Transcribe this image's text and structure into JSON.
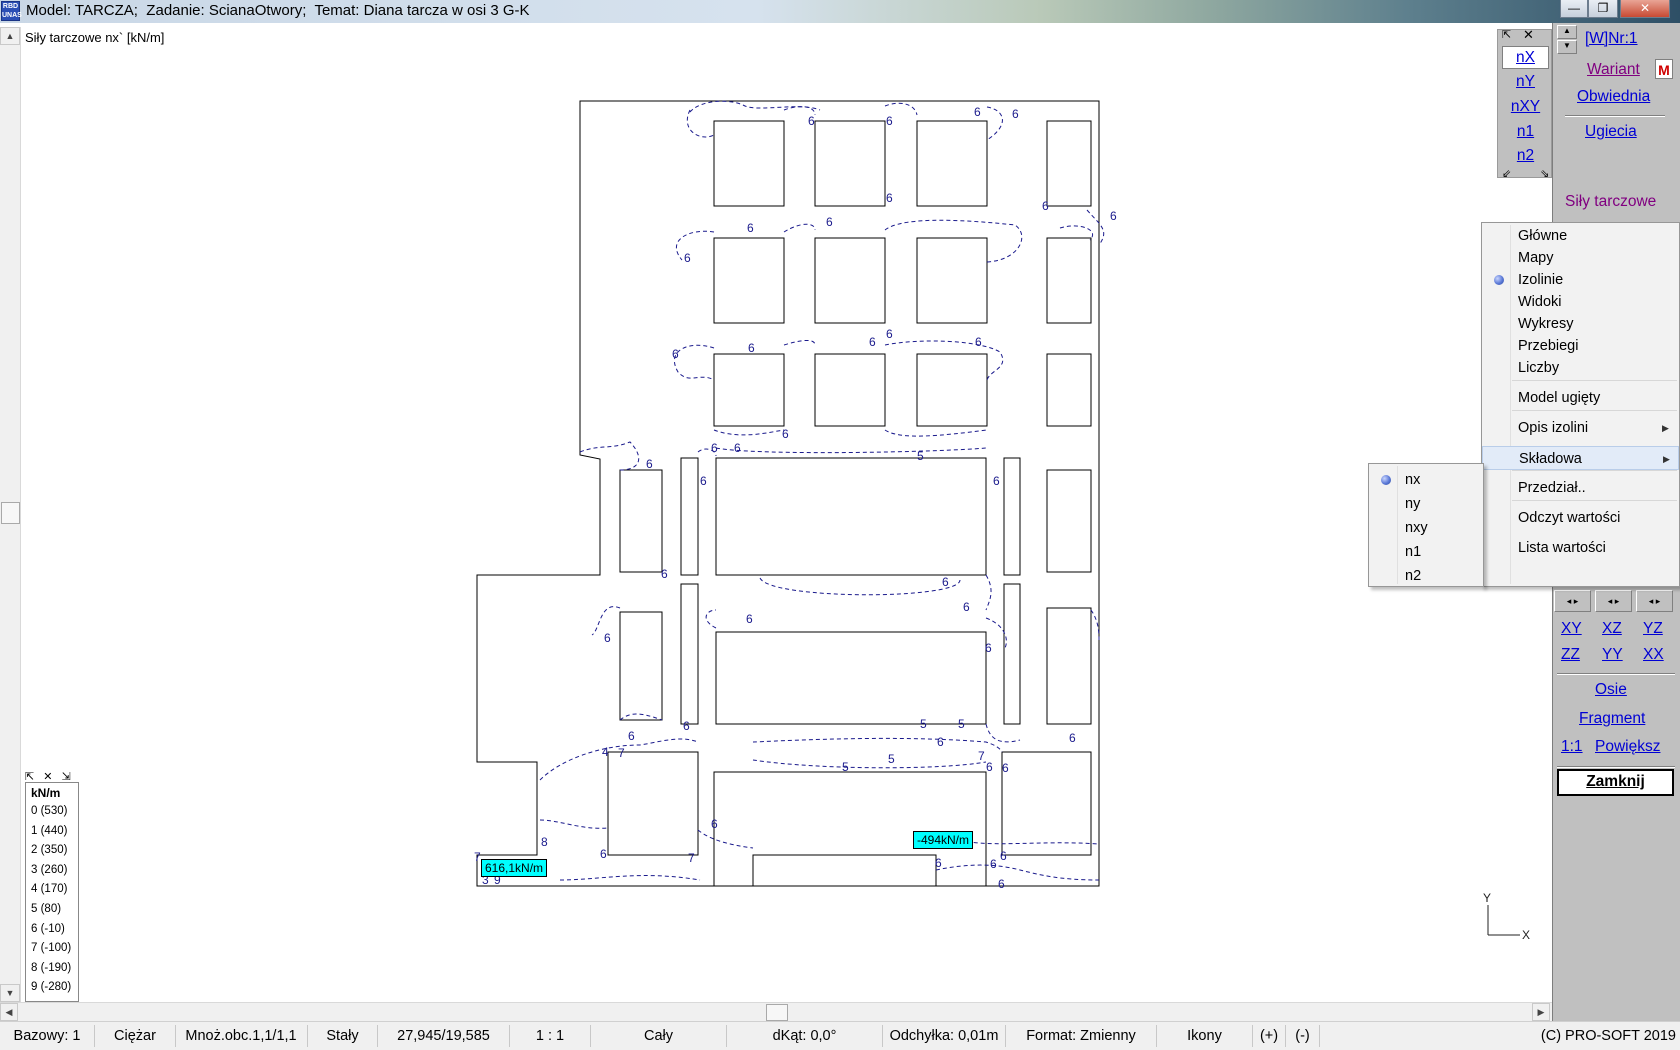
{
  "window": {
    "title": "Model: TARCZA;  Zadanie: ScianaOtwory;  Temat: Diana tarcza w osi 3 G-K",
    "icon_text": "RBD UNAS",
    "controls": [
      "minimize-icon",
      "maximize-icon",
      "close-icon"
    ]
  },
  "canvas": {
    "caption": "Siły tarczowe nx` [kN/m]",
    "contour_color": "#1a1a8c",
    "structure_color": "#000000"
  },
  "value_labels": [
    {
      "text": "616,1kN/m"
    },
    {
      "text": "-494kN/m"
    }
  ],
  "contour_digits": [
    "6",
    "6",
    "6",
    "6",
    "6",
    "6",
    "6",
    "6",
    "6",
    "6",
    "6",
    "6",
    "6",
    "6",
    "6",
    "6",
    "6",
    "6",
    "6",
    "6",
    "6",
    "6",
    "6",
    "6",
    "6",
    "6",
    "6",
    "6",
    "6",
    "6",
    "6",
    "6",
    "6",
    "5",
    "5",
    "5",
    "5",
    "5",
    "4",
    "7",
    "7",
    "7",
    "7",
    "3",
    "9",
    "8",
    "6",
    "6",
    "6",
    "6",
    "6",
    "6"
  ],
  "legend": {
    "title": "kN/m",
    "rows": [
      "0 (530)",
      "1 (440)",
      "2 (350)",
      "3 (260)",
      "4 (170)",
      "5 (80)",
      "6 (-10)",
      "7 (-100)",
      "8 (-190)",
      "9 (-280)"
    ]
  },
  "component_toolbox": {
    "items": [
      "nX",
      "nY",
      "nXY",
      "n1",
      "n2"
    ],
    "active": "nX"
  },
  "right_panel": {
    "wnr": "[W]Nr:1",
    "wariant": "Wariant",
    "m_badge": "M",
    "obwiednia": "Obwiednia",
    "ugiecia": "Ugiecia",
    "sily": "Siły tarczowe",
    "plane_buttons": [
      "XY",
      "XZ",
      "YZ",
      "ZZ",
      "YY",
      "XX"
    ],
    "osie": "Osie",
    "fragment": "Fragment",
    "scale": "1:1",
    "powieksz": "Powiększ",
    "zamknij": "Zamknij"
  },
  "context_menu": {
    "items": [
      {
        "label": "Główne"
      },
      {
        "label": "Mapy"
      },
      {
        "label": "Izolinie",
        "checked": true
      },
      {
        "label": "Widoki"
      },
      {
        "label": "Wykresy"
      },
      {
        "label": "Przebiegi"
      },
      {
        "label": "Liczby"
      },
      {
        "label": "Model ugięty"
      },
      {
        "label": "Opis izolini",
        "submenu": true
      },
      {
        "label": "Składowa",
        "submenu": true,
        "highlighted": true
      },
      {
        "label": "Przedział.."
      },
      {
        "label": "Odczyt wartości"
      },
      {
        "label": "Lista wartości"
      }
    ]
  },
  "submenu": {
    "items": [
      {
        "label": "nx",
        "checked": true
      },
      {
        "label": "ny"
      },
      {
        "label": "nxy"
      },
      {
        "label": "n1"
      },
      {
        "label": "n2"
      }
    ]
  },
  "axes_indicator": {
    "y": "Y",
    "x": "X"
  },
  "statusbar": {
    "cells": [
      "Bazowy: 1",
      "Ciężar",
      "Mnoż.obc.1,1/1,1",
      "Stały",
      "27,945/19,585",
      "1 : 1",
      "Cały",
      "dKąt: 0,0°",
      "Odchyłka: 0,01m",
      "Format: Zmienny",
      "Ikony",
      "(+)",
      "(-)",
      "(C) PRO-SOFT 2019"
    ]
  }
}
